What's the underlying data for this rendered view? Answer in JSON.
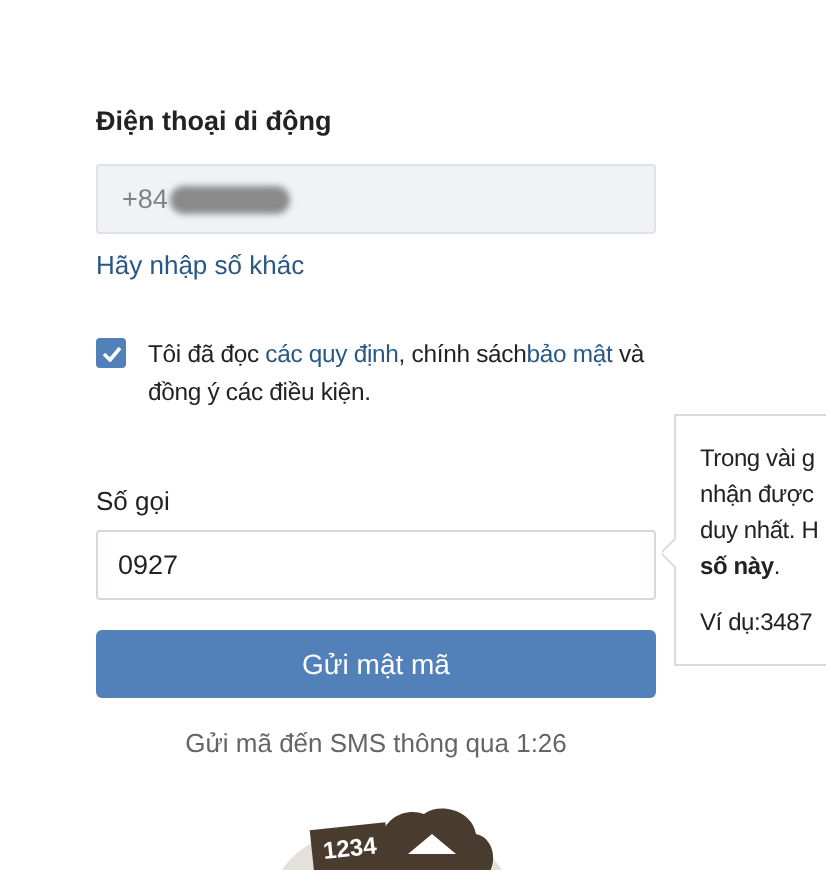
{
  "phone": {
    "label": "Điện thoại di động",
    "value": "+84",
    "redacted": true,
    "change_link": "Hãy nhập số khác"
  },
  "consent": {
    "checked": true,
    "parts": [
      {
        "kind": "text",
        "text": "Tôi đã đọc "
      },
      {
        "kind": "link",
        "text": "các quy định"
      },
      {
        "kind": "text",
        "text": ", chính sách"
      },
      {
        "kind": "link",
        "text": "bảo mật"
      },
      {
        "kind": "text",
        "text": " và đồng ý các điều kiện."
      }
    ]
  },
  "code": {
    "label": "Số gọi",
    "value": "0927"
  },
  "submit": "Gửi mật mã",
  "sms_note": "Gửi mã đến SMS thông qua 1:26",
  "tooltip": {
    "lines": [
      "Trong vài g",
      "nhận được",
      "duy nhất. H",
      "**số này**."
    ],
    "example": "Ví dụ:3487"
  },
  "illustration": {
    "card_text": "1234"
  }
}
